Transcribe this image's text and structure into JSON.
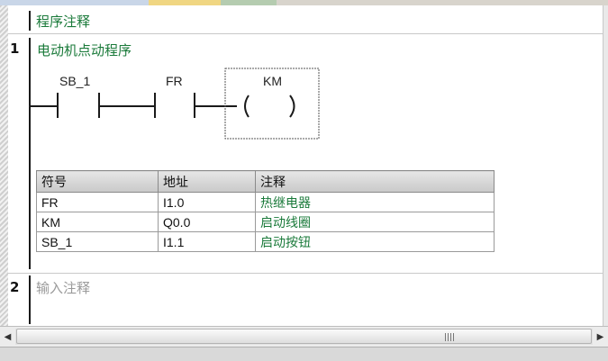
{
  "program_comment": "程序注释",
  "networks": [
    {
      "number": "1",
      "title": "电动机点动程序",
      "contacts": [
        {
          "symbol": "SB_1",
          "type": "normally-open"
        },
        {
          "symbol": "FR",
          "type": "normally-open"
        }
      ],
      "coil": {
        "symbol": "KM"
      }
    },
    {
      "number": "2",
      "title_placeholder": "输入注释"
    }
  ],
  "symbol_table": {
    "headers": [
      "符号",
      "地址",
      "注释"
    ],
    "rows": [
      {
        "symbol": "FR",
        "address": "I1.0",
        "comment": "热继电器"
      },
      {
        "symbol": "KM",
        "address": "Q0.0",
        "comment": "启动线圈"
      },
      {
        "symbol": "SB_1",
        "address": "I1.1",
        "comment": "启动按钮"
      }
    ]
  },
  "scrollbar": {
    "left_arrow": "◀",
    "right_arrow": "▶"
  },
  "colors": {
    "comment_green": "#1a7a3a",
    "placeholder_gray": "#9a9a9a"
  }
}
